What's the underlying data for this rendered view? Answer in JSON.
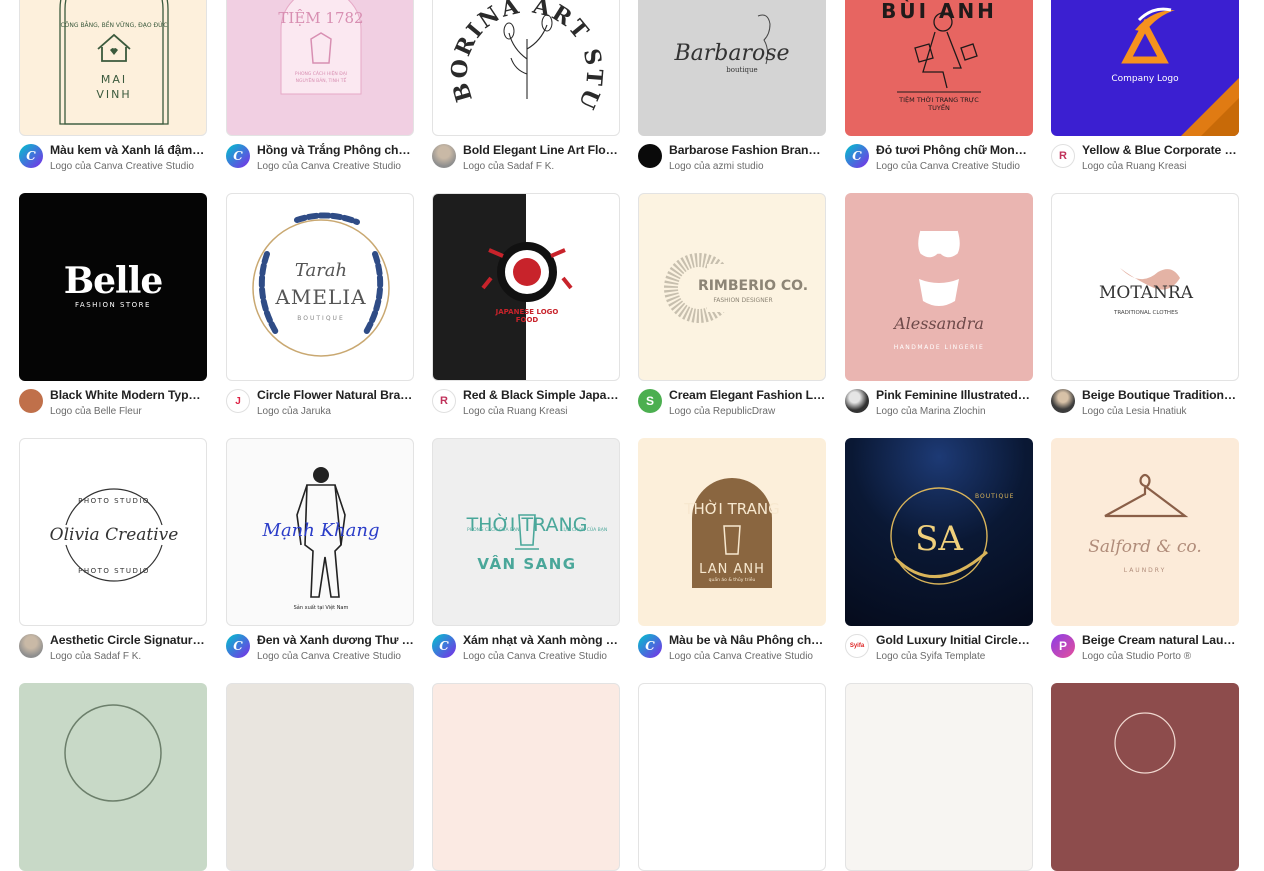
{
  "templates": [
    {
      "title": "Màu kem và Xanh lá đậm Hình...",
      "author": "Logo của Canva Creative Studio",
      "bg": "#fdf0dc",
      "avatar": "C"
    },
    {
      "title": "Hồng và Trắng Phông chữ Mo...",
      "author": "Logo của Canva Creative Studio",
      "bg": "#f1cfe2",
      "avatar": "C"
    },
    {
      "title": "Bold Elegant Line Art Floral Lo...",
      "author": "Logo của Sadaf F K.",
      "bg": "#ffffff",
      "avatar": ""
    },
    {
      "title": "Barbarose Fashion Brand Art ...",
      "author": "Logo của azmi studio",
      "bg": "#d4d4d4",
      "avatar": ""
    },
    {
      "title": "Đỏ tươi Phông chữ Monoline ...",
      "author": "Logo của Canva Creative Studio",
      "bg": "#e76561",
      "avatar": "C"
    },
    {
      "title": "Yellow & Blue Corporate Simp...",
      "author": "Logo của Ruang Kreasi",
      "bg": "#3b1fd1",
      "avatar": "R"
    },
    {
      "title": "Black White Modern Typograp...",
      "author": "Logo của Belle Fleur",
      "bg": "#050505",
      "avatar": ""
    },
    {
      "title": "Circle Flower Natural Brand L...",
      "author": "Logo của Jaruka",
      "bg": "#ffffff",
      "avatar": "J"
    },
    {
      "title": "Red & Black Simple Japanese ...",
      "author": "Logo của Ruang Kreasi",
      "bg": "#ffffff",
      "avatar": "R"
    },
    {
      "title": "Cream Elegant Fashion Logo",
      "author": "Logo của RepublicDraw",
      "bg": "#fcf3e1",
      "avatar": "S"
    },
    {
      "title": "Pink Feminine Illustrated Lin...",
      "author": "Logo của Marina Zlochin",
      "bg": "#eab5b1",
      "avatar": ""
    },
    {
      "title": "Beige Boutique Traditional Cl...",
      "author": "Logo của Lesia Hnatiuk",
      "bg": "#ffffff",
      "avatar": ""
    },
    {
      "title": "Aesthetic Circle Signature Ph...",
      "author": "Logo của Sadaf F K.",
      "bg": "#ffffff",
      "avatar": ""
    },
    {
      "title": "Đen và Xanh dương Thư phá...",
      "author": "Logo của Canva Creative Studio",
      "bg": "#fafafa",
      "avatar": "C"
    },
    {
      "title": "Xám nhạt và Xanh mòng két ...",
      "author": "Logo của Canva Creative Studio",
      "bg": "#efefef",
      "avatar": "C"
    },
    {
      "title": "Màu be và Nâu Phông chữ M...",
      "author": "Logo của Canva Creative Studio",
      "bg": "#fcefda",
      "avatar": "C"
    },
    {
      "title": "Gold Luxury Initial Circle Log...",
      "author": "Logo của Syifa Template",
      "bg": "#08152e",
      "avatar": "Syifa"
    },
    {
      "title": "Beige Cream natural Laundry...",
      "author": "Logo của Studio Porto ®",
      "bg": "#fcebd9",
      "avatar": "P"
    }
  ],
  "bottom_row": [
    {
      "bg": "#c8d9c7"
    },
    {
      "bg": "#e9e5df"
    },
    {
      "bg": "#fbeae3"
    },
    {
      "bg": "#ffffff"
    },
    {
      "bg": "#f7f5f2"
    },
    {
      "bg": "#8d4c4c"
    }
  ],
  "art": {
    "t0": {
      "arc": "CÔNG BẰNG, BỀN VỮNG, ĐẠO ĐỨC",
      "l1": "MAI",
      "l2": "VINH"
    },
    "t1": {
      "l1": "TIỆM 1782",
      "l2": "PHONG CÁCH HIỆN ĐẠI",
      "l3": "NGUYÊN BẢN, TINH TẾ"
    },
    "t2": {
      "arc": "BORINA ART STUDIO"
    },
    "t3": {
      "l1": "Barbarose",
      "l2": "boutique"
    },
    "t4": {
      "l1": "BÙI ANH",
      "l2": "TIỆM THỜI TRANG TRỰC",
      "l3": "TUYẾN"
    },
    "t5": {
      "l1": "Company Logo"
    },
    "t6": {
      "l1": "Belle",
      "l2": "FASHION STORE"
    },
    "t7": {
      "l1": "Tarah",
      "l2": "AMELIA",
      "l3": "BOUTIQUE"
    },
    "t8": {
      "l1": "JAPANESE LOGO",
      "l2": "FOOD"
    },
    "t9": {
      "l1": "RIMBERIO CO.",
      "l2": "FASHION DESIGNER"
    },
    "t10": {
      "l1": "Alessandra",
      "l2": "HANDMADE LINGERIE"
    },
    "t11": {
      "l1": "MOTANRA",
      "l2": "TRADITIONAL CLOTHES"
    },
    "t12": {
      "l1": "Olivia Creative",
      "l2": "PHOTO STUDIO",
      "l3": "PHOTO STUDIO"
    },
    "t13": {
      "l1": "Mạnh Khang",
      "l2": "Sản xuất tại Việt Nam"
    },
    "t14": {
      "l1": "THỜI TRANG",
      "l2": "VÂN SANG",
      "l3": "PHONG CÁCH CỦA BẠN",
      "l4": "LỰA CHỌN CỦA BẠN"
    },
    "t15": {
      "l1": "THỜI TRANG",
      "l2": "LAN ANH",
      "l3": "quần áo & thủy triều"
    },
    "t16": {
      "l1": "SA",
      "l2": "BOUTIQUE"
    },
    "t17": {
      "l1": "Salford & co.",
      "l2": "LAUNDRY"
    }
  },
  "colors": {
    "text": "#222222",
    "subtext": "#6b6b6b",
    "canva_a": "#00c4cc",
    "canva_b": "#7d2ae8"
  }
}
